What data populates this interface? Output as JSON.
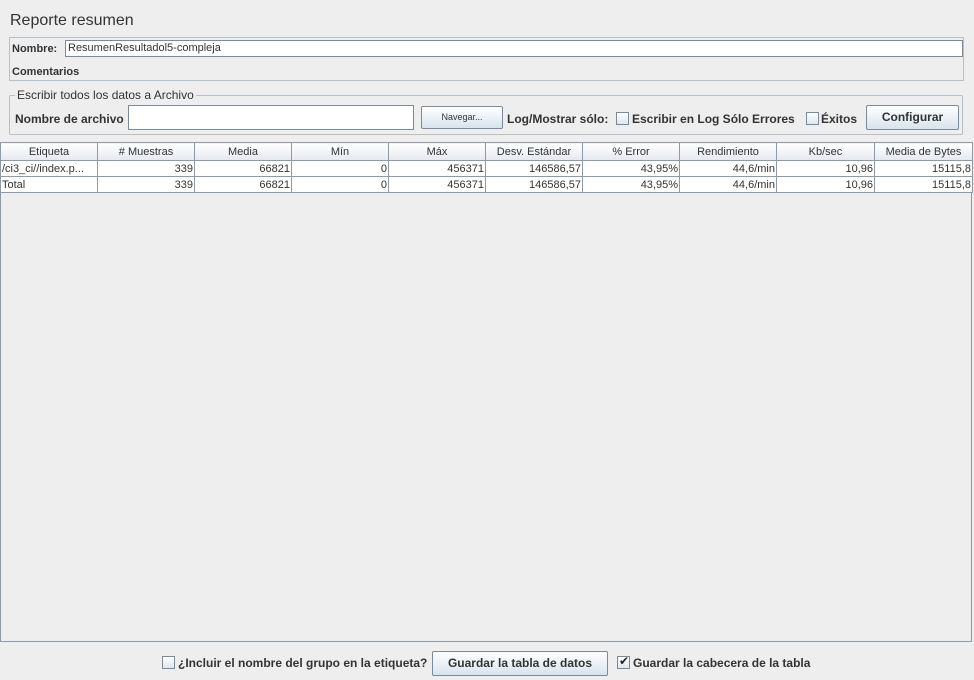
{
  "page": {
    "title": "Reporte resumen"
  },
  "name_panel": {
    "name_label": "Nombre:",
    "name_value": "ResumenResultadol5-compleja",
    "comments_label": "Comentarios"
  },
  "file_panel": {
    "legend": "Escribir todos los datos a Archivo",
    "filename_label": "Nombre de archivo",
    "filename_value": "",
    "browse_label": "Navegar...",
    "log_show_label": "Log/Mostrar sólo:",
    "errors_only_label": "Escribir en Log Sólo Errores",
    "errors_only_checked": false,
    "successes_label": "Éxitos",
    "successes_checked": false,
    "configure_label": "Configurar"
  },
  "table": {
    "columns": [
      "Etiqueta",
      "# Muestras",
      "Media",
      "Mín",
      "Máx",
      "Desv. Estándar",
      "% Error",
      "Rendimiento",
      "Kb/sec",
      "Media de Bytes"
    ],
    "rows": [
      [
        "/ci3_ci//index.p...",
        "339",
        "66821",
        "0",
        "456371",
        "146586,57",
        "43,95%",
        "44,6/min",
        "10,96",
        "15115,8"
      ],
      [
        "Total",
        "339",
        "66821",
        "0",
        "456371",
        "146586,57",
        "43,95%",
        "44,6/min",
        "10,96",
        "15115,8"
      ]
    ]
  },
  "bottom_bar": {
    "include_group_label": "¿Incluir el nombre del grupo en la etiqueta?",
    "include_group_checked": false,
    "save_table_label": "Guardar la tabla de datos",
    "save_header_label": "Guardar la cabecera de la tabla",
    "save_header_checked": true,
    "checkmark_glyph": "✔"
  },
  "colors": {
    "background": "#eeeeee",
    "border": "#8e9aa6",
    "button_gradient_end": "#d8e3ee"
  }
}
